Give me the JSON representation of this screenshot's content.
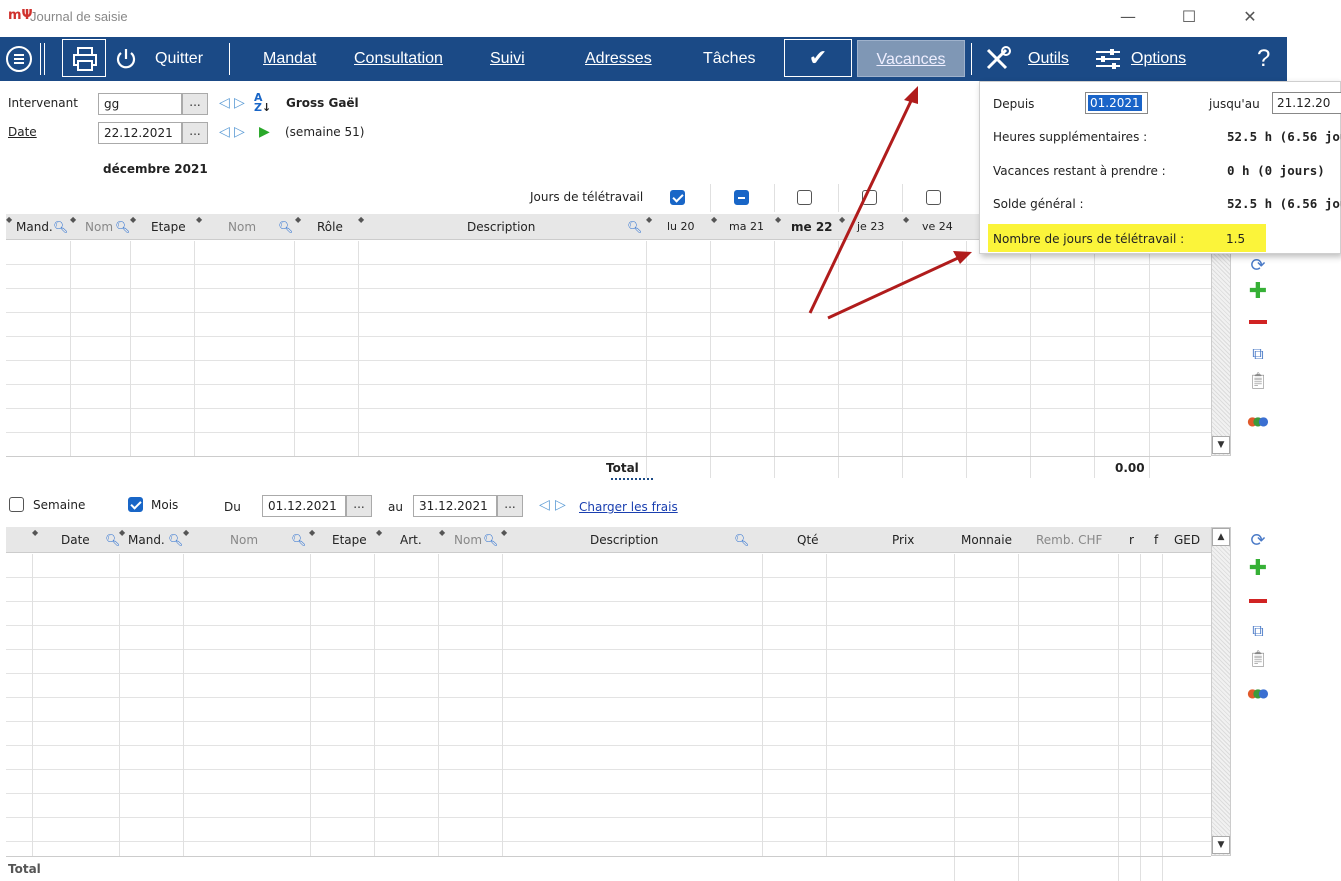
{
  "window": {
    "logo": "mΨ",
    "title": "Journal de saisie",
    "minimize": "—",
    "maximize": "☐",
    "close": "✕"
  },
  "menu": {
    "quit": "Quitter",
    "mandat": "Mandat",
    "consultation": "Consultation",
    "suivi": "Suivi",
    "adresses": "Adresses",
    "taches": "Tâches",
    "check": "✔",
    "vacances": "Vacances",
    "outils": "Outils",
    "options": "Options",
    "help": "?"
  },
  "header": {
    "intervenant_label": "Intervenant",
    "intervenant_value": "gg",
    "intervenant_name": "Gross Gaël",
    "date_label": "Date",
    "date_value": "22.12.2021",
    "week": "(semaine 51)",
    "month": "décembre 2021",
    "dots": "...",
    "teletravail_label": "Jours de télétravail"
  },
  "top_table": {
    "headers": [
      "Mand.",
      "Nom",
      "Etape",
      "Nom",
      "Rôle",
      "Description",
      "lu 20",
      "ma 21",
      "me 22",
      "je 23",
      "ve 24"
    ],
    "total_label": "Total",
    "total_value": "0.00"
  },
  "filters": {
    "semaine": "Semaine",
    "mois": "Mois",
    "du_label": "Du",
    "du_value": "01.12.2021",
    "au_label": "au",
    "au_value": "31.12.2021",
    "charger": "Charger les frais"
  },
  "bottom_table": {
    "headers": [
      "Date",
      "Mand.",
      "Nom",
      "Etape",
      "Art.",
      "Nom",
      "Description",
      "Qté",
      "Prix",
      "Monnaie",
      "Remb. CHF",
      "r",
      "f",
      "GED"
    ],
    "total_label": "Total"
  },
  "popup": {
    "depuis_label": "Depuis",
    "depuis_value": "01.2021",
    "jusquau_label": "jusqu'au",
    "jusquau_value": "21.12.20",
    "heures_label": "Heures supplémentaires :",
    "heures_value": "52.5 h (6.56 jou",
    "vacances_label": "Vacances restant à prendre :",
    "vacances_value": "0 h (0 jours)",
    "solde_label": "Solde général :",
    "solde_value": "52.5 h (6.56 jou",
    "teletravail_label": "Nombre de jours de télétravail :",
    "teletravail_value": "1.5"
  },
  "colors": {
    "menu_bg": "#1b4a86",
    "highlight": "#fbf43a",
    "arrow": "#b01c1c"
  }
}
